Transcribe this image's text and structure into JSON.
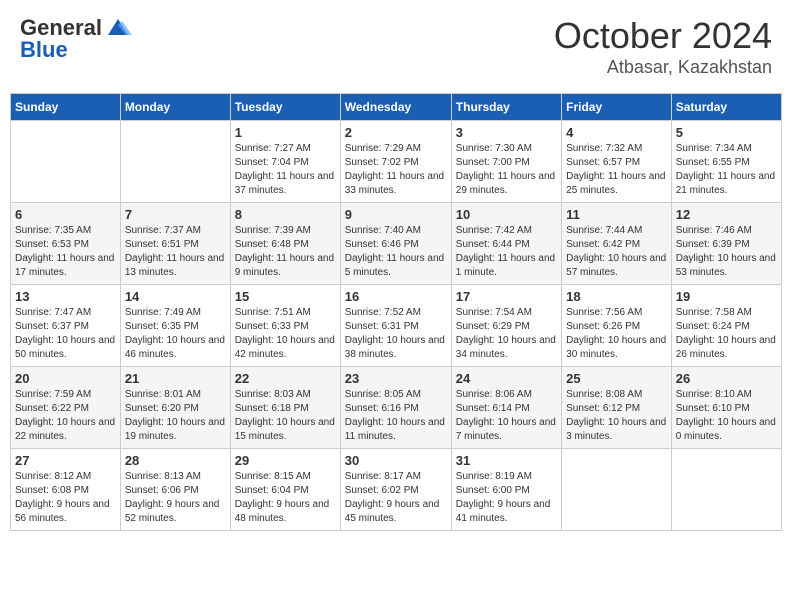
{
  "header": {
    "logo_general": "General",
    "logo_blue": "Blue",
    "month": "October 2024",
    "location": "Atbasar, Kazakhstan"
  },
  "weekdays": [
    "Sunday",
    "Monday",
    "Tuesday",
    "Wednesday",
    "Thursday",
    "Friday",
    "Saturday"
  ],
  "weeks": [
    [
      {
        "day": "",
        "sunrise": "",
        "sunset": "",
        "daylight": ""
      },
      {
        "day": "",
        "sunrise": "",
        "sunset": "",
        "daylight": ""
      },
      {
        "day": "1",
        "sunrise": "Sunrise: 7:27 AM",
        "sunset": "Sunset: 7:04 PM",
        "daylight": "Daylight: 11 hours and 37 minutes."
      },
      {
        "day": "2",
        "sunrise": "Sunrise: 7:29 AM",
        "sunset": "Sunset: 7:02 PM",
        "daylight": "Daylight: 11 hours and 33 minutes."
      },
      {
        "day": "3",
        "sunrise": "Sunrise: 7:30 AM",
        "sunset": "Sunset: 7:00 PM",
        "daylight": "Daylight: 11 hours and 29 minutes."
      },
      {
        "day": "4",
        "sunrise": "Sunrise: 7:32 AM",
        "sunset": "Sunset: 6:57 PM",
        "daylight": "Daylight: 11 hours and 25 minutes."
      },
      {
        "day": "5",
        "sunrise": "Sunrise: 7:34 AM",
        "sunset": "Sunset: 6:55 PM",
        "daylight": "Daylight: 11 hours and 21 minutes."
      }
    ],
    [
      {
        "day": "6",
        "sunrise": "Sunrise: 7:35 AM",
        "sunset": "Sunset: 6:53 PM",
        "daylight": "Daylight: 11 hours and 17 minutes."
      },
      {
        "day": "7",
        "sunrise": "Sunrise: 7:37 AM",
        "sunset": "Sunset: 6:51 PM",
        "daylight": "Daylight: 11 hours and 13 minutes."
      },
      {
        "day": "8",
        "sunrise": "Sunrise: 7:39 AM",
        "sunset": "Sunset: 6:48 PM",
        "daylight": "Daylight: 11 hours and 9 minutes."
      },
      {
        "day": "9",
        "sunrise": "Sunrise: 7:40 AM",
        "sunset": "Sunset: 6:46 PM",
        "daylight": "Daylight: 11 hours and 5 minutes."
      },
      {
        "day": "10",
        "sunrise": "Sunrise: 7:42 AM",
        "sunset": "Sunset: 6:44 PM",
        "daylight": "Daylight: 11 hours and 1 minute."
      },
      {
        "day": "11",
        "sunrise": "Sunrise: 7:44 AM",
        "sunset": "Sunset: 6:42 PM",
        "daylight": "Daylight: 10 hours and 57 minutes."
      },
      {
        "day": "12",
        "sunrise": "Sunrise: 7:46 AM",
        "sunset": "Sunset: 6:39 PM",
        "daylight": "Daylight: 10 hours and 53 minutes."
      }
    ],
    [
      {
        "day": "13",
        "sunrise": "Sunrise: 7:47 AM",
        "sunset": "Sunset: 6:37 PM",
        "daylight": "Daylight: 10 hours and 50 minutes."
      },
      {
        "day": "14",
        "sunrise": "Sunrise: 7:49 AM",
        "sunset": "Sunset: 6:35 PM",
        "daylight": "Daylight: 10 hours and 46 minutes."
      },
      {
        "day": "15",
        "sunrise": "Sunrise: 7:51 AM",
        "sunset": "Sunset: 6:33 PM",
        "daylight": "Daylight: 10 hours and 42 minutes."
      },
      {
        "day": "16",
        "sunrise": "Sunrise: 7:52 AM",
        "sunset": "Sunset: 6:31 PM",
        "daylight": "Daylight: 10 hours and 38 minutes."
      },
      {
        "day": "17",
        "sunrise": "Sunrise: 7:54 AM",
        "sunset": "Sunset: 6:29 PM",
        "daylight": "Daylight: 10 hours and 34 minutes."
      },
      {
        "day": "18",
        "sunrise": "Sunrise: 7:56 AM",
        "sunset": "Sunset: 6:26 PM",
        "daylight": "Daylight: 10 hours and 30 minutes."
      },
      {
        "day": "19",
        "sunrise": "Sunrise: 7:58 AM",
        "sunset": "Sunset: 6:24 PM",
        "daylight": "Daylight: 10 hours and 26 minutes."
      }
    ],
    [
      {
        "day": "20",
        "sunrise": "Sunrise: 7:59 AM",
        "sunset": "Sunset: 6:22 PM",
        "daylight": "Daylight: 10 hours and 22 minutes."
      },
      {
        "day": "21",
        "sunrise": "Sunrise: 8:01 AM",
        "sunset": "Sunset: 6:20 PM",
        "daylight": "Daylight: 10 hours and 19 minutes."
      },
      {
        "day": "22",
        "sunrise": "Sunrise: 8:03 AM",
        "sunset": "Sunset: 6:18 PM",
        "daylight": "Daylight: 10 hours and 15 minutes."
      },
      {
        "day": "23",
        "sunrise": "Sunrise: 8:05 AM",
        "sunset": "Sunset: 6:16 PM",
        "daylight": "Daylight: 10 hours and 11 minutes."
      },
      {
        "day": "24",
        "sunrise": "Sunrise: 8:06 AM",
        "sunset": "Sunset: 6:14 PM",
        "daylight": "Daylight: 10 hours and 7 minutes."
      },
      {
        "day": "25",
        "sunrise": "Sunrise: 8:08 AM",
        "sunset": "Sunset: 6:12 PM",
        "daylight": "Daylight: 10 hours and 3 minutes."
      },
      {
        "day": "26",
        "sunrise": "Sunrise: 8:10 AM",
        "sunset": "Sunset: 6:10 PM",
        "daylight": "Daylight: 10 hours and 0 minutes."
      }
    ],
    [
      {
        "day": "27",
        "sunrise": "Sunrise: 8:12 AM",
        "sunset": "Sunset: 6:08 PM",
        "daylight": "Daylight: 9 hours and 56 minutes."
      },
      {
        "day": "28",
        "sunrise": "Sunrise: 8:13 AM",
        "sunset": "Sunset: 6:06 PM",
        "daylight": "Daylight: 9 hours and 52 minutes."
      },
      {
        "day": "29",
        "sunrise": "Sunrise: 8:15 AM",
        "sunset": "Sunset: 6:04 PM",
        "daylight": "Daylight: 9 hours and 48 minutes."
      },
      {
        "day": "30",
        "sunrise": "Sunrise: 8:17 AM",
        "sunset": "Sunset: 6:02 PM",
        "daylight": "Daylight: 9 hours and 45 minutes."
      },
      {
        "day": "31",
        "sunrise": "Sunrise: 8:19 AM",
        "sunset": "Sunset: 6:00 PM",
        "daylight": "Daylight: 9 hours and 41 minutes."
      },
      {
        "day": "",
        "sunrise": "",
        "sunset": "",
        "daylight": ""
      },
      {
        "day": "",
        "sunrise": "",
        "sunset": "",
        "daylight": ""
      }
    ]
  ]
}
